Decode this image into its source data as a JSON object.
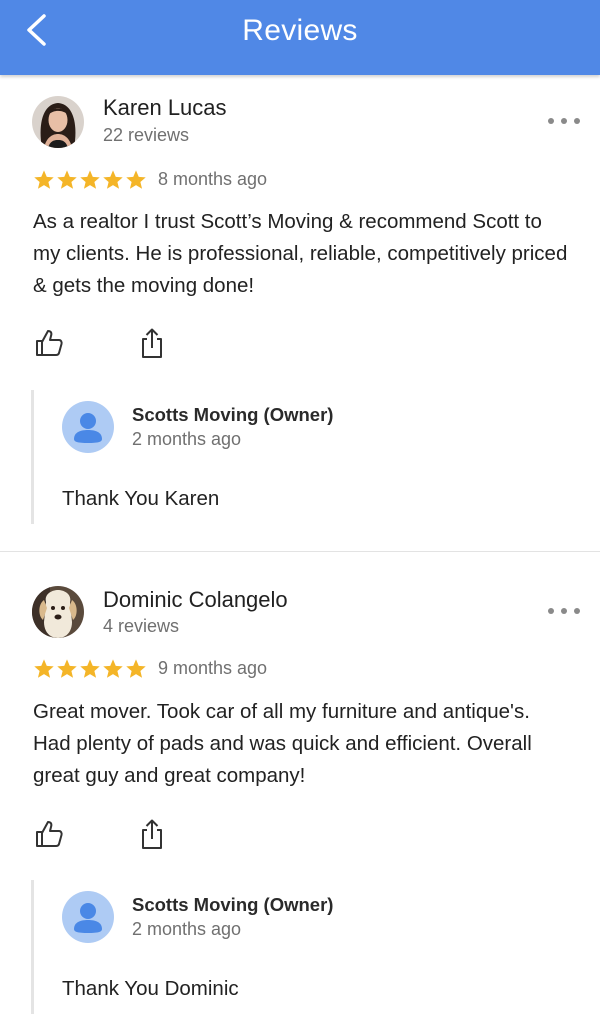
{
  "app_bar": {
    "title": "Reviews",
    "back_icon": "chevron-left-icon",
    "color": "#5088e6"
  },
  "reviews": [
    {
      "reviewer": "Karen Lucas",
      "review_count": "22 reviews",
      "rating": 5,
      "time": "8 months ago",
      "text": "As a realtor I trust Scott’s Moving & recommend Scott to  my clients. He is professional, reliable, competitively priced & gets the moving done!",
      "avatar": "photo-woman-avatar",
      "reply": {
        "owner_name": "Scotts Moving (Owner)",
        "time": "2 months ago",
        "text": "Thank You Karen"
      }
    },
    {
      "reviewer": "Dominic Colangelo",
      "review_count": "4 reviews",
      "rating": 5,
      "time": "9 months ago",
      "text": "Great mover. Took car of all my furniture and antique's. Had plenty of pads and was quick and efficient. Overall great guy and great company!",
      "avatar": "photo-dog-avatar",
      "reply": {
        "owner_name": "Scotts Moving (Owner)",
        "time": "2 months ago",
        "text": "Thank You Dominic"
      }
    }
  ],
  "colors": {
    "star": "#f4b528",
    "owner_avatar_bg": "#aecbf4",
    "owner_avatar_fg": "#4a88e6"
  }
}
